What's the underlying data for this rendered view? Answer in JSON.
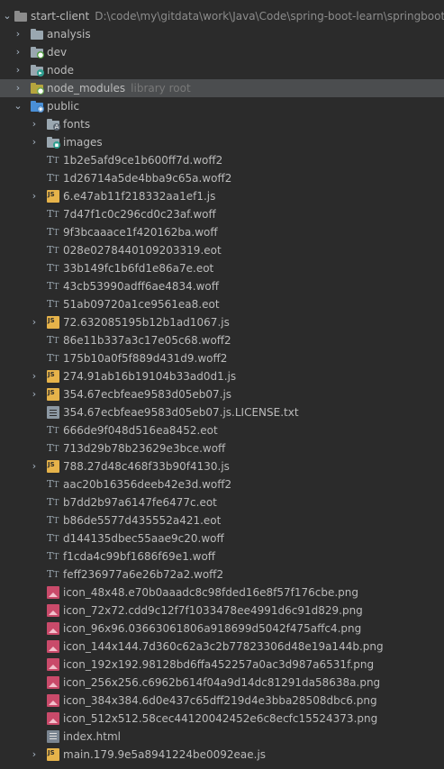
{
  "project": {
    "name": "start-client",
    "path": "D:\\code\\my\\gitdata\\work\\Java\\Code\\spring-boot-learn\\springboot"
  },
  "folders": {
    "analysis": "analysis",
    "dev": "dev",
    "node": "node",
    "node_modules": "node_modules",
    "node_modules_hint": "library root",
    "public": "public",
    "fonts": "fonts",
    "images": "images"
  },
  "files": [
    {
      "name": "1b2e5afd9ce1b600ff7d.woff2",
      "type": "font"
    },
    {
      "name": "1d26714a5de4bba9c65a.woff2",
      "type": "font"
    },
    {
      "name": "6.e47ab11f218332aa1ef1.js",
      "type": "js"
    },
    {
      "name": "7d47f1c0c296cd0c23af.woff",
      "type": "font"
    },
    {
      "name": "9f3bcaaace1f420162ba.woff",
      "type": "font"
    },
    {
      "name": "028e0278440109203319.eot",
      "type": "font"
    },
    {
      "name": "33b149fc1b6fd1e86a7e.eot",
      "type": "font"
    },
    {
      "name": "43cb53990adff6ae4834.woff",
      "type": "font"
    },
    {
      "name": "51ab09720a1ce9561ea8.eot",
      "type": "font"
    },
    {
      "name": "72.632085195b12b1ad1067.js",
      "type": "js"
    },
    {
      "name": "86e11b337a3c17e05c68.woff2",
      "type": "font"
    },
    {
      "name": "175b10a0f5f889d431d9.woff2",
      "type": "font"
    },
    {
      "name": "274.91ab16b19104b33ad0d1.js",
      "type": "js"
    },
    {
      "name": "354.67ecbfeae9583d05eb07.js",
      "type": "js"
    },
    {
      "name": "354.67ecbfeae9583d05eb07.js.LICENSE.txt",
      "type": "txt"
    },
    {
      "name": "666de9f048d516ea8452.eot",
      "type": "font"
    },
    {
      "name": "713d29b78b23629e3bce.woff",
      "type": "font"
    },
    {
      "name": "788.27d48c468f33b90f4130.js",
      "type": "js"
    },
    {
      "name": "aac20b16356deeb42e3d.woff2",
      "type": "font"
    },
    {
      "name": "b7dd2b97a6147fe6477c.eot",
      "type": "font"
    },
    {
      "name": "b86de5577d435552a421.eot",
      "type": "font"
    },
    {
      "name": "d144135dbec55aae9c20.woff",
      "type": "font"
    },
    {
      "name": "f1cda4c99bf1686f69e1.woff",
      "type": "font"
    },
    {
      "name": "feff236977a6e26b72a2.woff2",
      "type": "font"
    },
    {
      "name": "icon_48x48.e70b0aaadc8c98fded16e8f57f176cbe.png",
      "type": "png"
    },
    {
      "name": "icon_72x72.cdd9c12f7f1033478ee4991d6c91d829.png",
      "type": "png"
    },
    {
      "name": "icon_96x96.03663061806a918699d5042f475affc4.png",
      "type": "png"
    },
    {
      "name": "icon_144x144.7d360c62a3c2b77823306d48e19a144b.png",
      "type": "png"
    },
    {
      "name": "icon_192x192.98128bd6ffa452257a0ac3d987a6531f.png",
      "type": "png"
    },
    {
      "name": "icon_256x256.c6962b614f04a9d14dc81291da58638a.png",
      "type": "png"
    },
    {
      "name": "icon_384x384.6d0e437c65dff219d4e3bba28508dbc6.png",
      "type": "png"
    },
    {
      "name": "icon_512x512.58cec44120042452e6c8ecfc15524373.png",
      "type": "png"
    },
    {
      "name": "index.html",
      "type": "html"
    },
    {
      "name": "main.179.9e5a8941224be0092eae.js",
      "type": "js"
    }
  ]
}
